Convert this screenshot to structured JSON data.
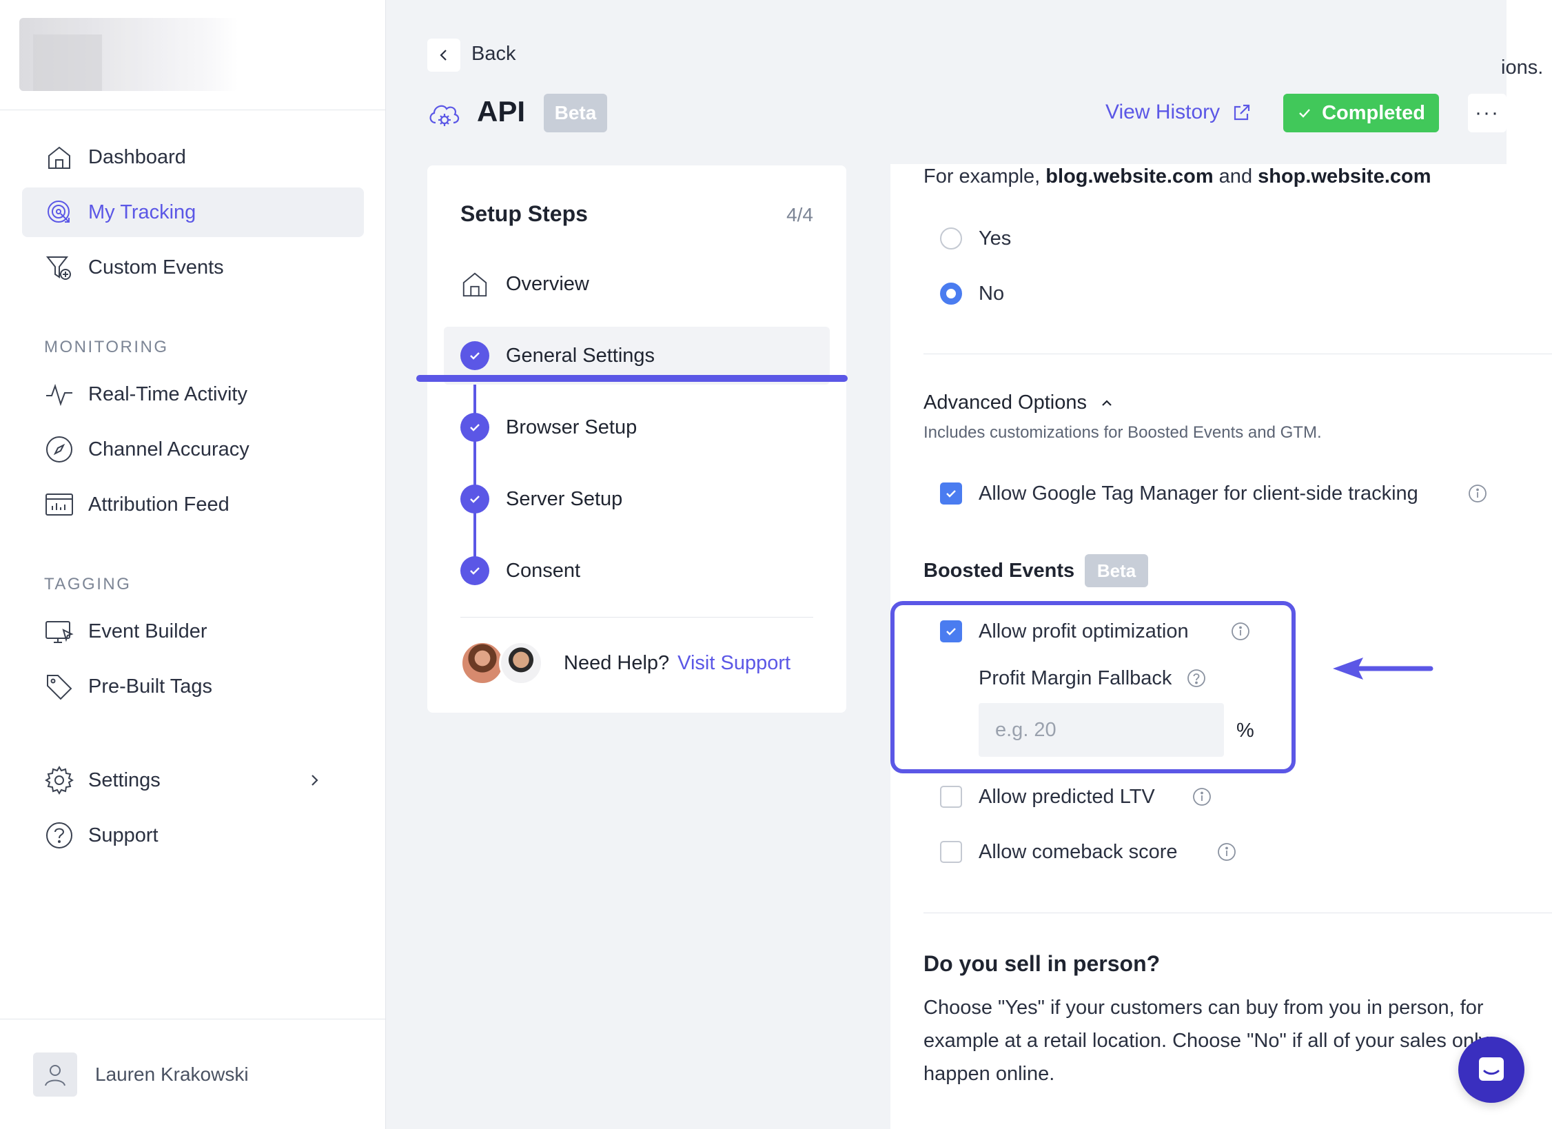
{
  "sidebar": {
    "nav": [
      {
        "label": "Dashboard",
        "icon": "home-icon"
      },
      {
        "label": "My Tracking",
        "icon": "tracking-icon",
        "active": true
      },
      {
        "label": "Custom Events",
        "icon": "funnel-plus-icon"
      }
    ],
    "monitoring_label": "MONITORING",
    "monitoring": [
      {
        "label": "Real-Time Activity",
        "icon": "activity-icon"
      },
      {
        "label": "Channel Accuracy",
        "icon": "compass-icon"
      },
      {
        "label": "Attribution Feed",
        "icon": "feed-icon"
      }
    ],
    "tagging_label": "TAGGING",
    "tagging": [
      {
        "label": "Event Builder",
        "icon": "monitor-cursor-icon"
      },
      {
        "label": "Pre-Built Tags",
        "icon": "tag-icon"
      }
    ],
    "settings_label": "Settings",
    "support_label": "Support",
    "user_name": "Lauren Krakowski"
  },
  "header": {
    "back_label": "Back",
    "title": "API",
    "badge": "Beta",
    "view_history": "View History",
    "completed": "Completed",
    "more": "···",
    "cut_text": "ions."
  },
  "steps": {
    "title": "Setup Steps",
    "count": "4/4",
    "items": [
      {
        "label": "Overview"
      },
      {
        "label": "General Settings",
        "active": true
      },
      {
        "label": "Browser Setup"
      },
      {
        "label": "Server Setup"
      },
      {
        "label": "Consent"
      }
    ],
    "help_text": "Need Help?",
    "help_link": "Visit Support"
  },
  "main": {
    "example_prefix": "For example, ",
    "example_a": "blog.website.com",
    "example_mid": " and ",
    "example_b": "shop.website.com",
    "radio_yes": "Yes",
    "radio_no": "No",
    "radio_selected": "No",
    "advanced_title": "Advanced Options",
    "advanced_sub": "Includes customizations for Boosted Events and GTM.",
    "gtm_label": "Allow Google Tag Manager for client-side tracking",
    "boosted_title": "Boosted Events",
    "boosted_badge": "Beta",
    "profit_label": "Allow profit optimization",
    "fallback_label": "Profit Margin Fallback",
    "fallback_placeholder": "e.g. 20",
    "fallback_value": "",
    "pct": "%",
    "ltv_label": "Allow predicted LTV",
    "comeback_label": "Allow comeback score",
    "inperson_title": "Do you sell in person?",
    "inperson_text": "Choose \"Yes\" if your customers can buy from you in person, for example at a retail location. Choose \"No\" if all of your sales only happen online."
  },
  "colors": {
    "accent": "#5b57e6",
    "checkbox_blue": "#4a7cf0",
    "completed_green": "#41c85a",
    "badge_gray": "#c8ced8"
  }
}
